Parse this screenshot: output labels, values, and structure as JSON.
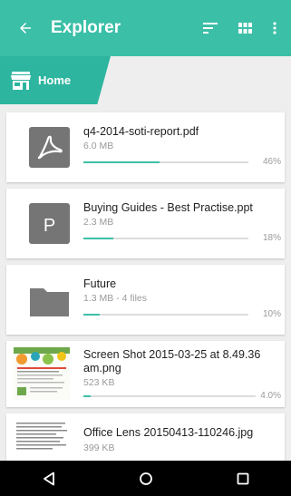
{
  "appbar": {
    "title": "Explorer",
    "back_icon": "arrow-back-icon",
    "actions": [
      "sort-icon",
      "grid-view-icon",
      "more-vert-icon"
    ]
  },
  "breadcrumb": {
    "label": "Home",
    "icon": "store-icon"
  },
  "files": [
    {
      "name": "q4-2014-soti-report.pdf",
      "meta": "6.0 MB",
      "progress_label": "46%",
      "progress": 0.46,
      "icon": "pdf-icon"
    },
    {
      "name": "Buying Guides - Best Practise.ppt",
      "meta": "2.3 MB",
      "progress_label": "18%",
      "progress": 0.18,
      "icon": "presentation-icon"
    },
    {
      "name": "Future",
      "meta": "1.3 MB - 4 files",
      "progress_label": "10%",
      "progress": 0.1,
      "icon": "folder-icon"
    },
    {
      "name": "Screen Shot 2015-03-25 at 8.49.36 am.png",
      "meta": "523 KB",
      "progress_label": "4.0%",
      "progress": 0.04,
      "icon": "image-thumbnail"
    },
    {
      "name": "Office Lens 20150413-110246.jpg",
      "meta": "399 KB",
      "progress_label": "",
      "progress": 0,
      "icon": "image-thumbnail"
    }
  ],
  "navbar": {
    "buttons": [
      "back-nav-icon",
      "home-nav-icon",
      "recents-nav-icon"
    ]
  },
  "colors": {
    "accent": "#3bbfa7",
    "breadcrumb": "#2eb59f",
    "icon_grey": "#757575"
  }
}
